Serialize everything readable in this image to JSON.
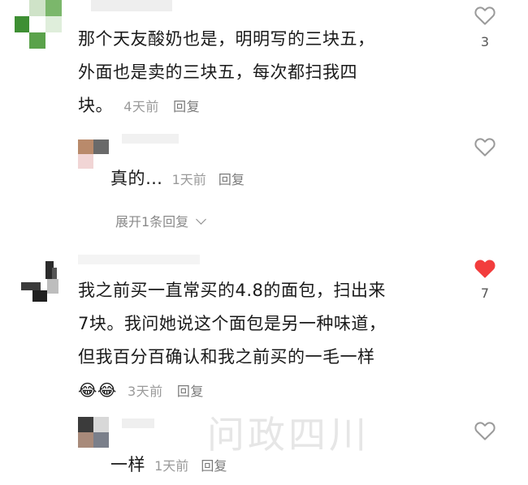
{
  "comments": [
    {
      "lines": [
        "那个天友酸奶也是，明明写的三块五，",
        "外面也是卖的三块五，每次都扫我四",
        "块。"
      ],
      "time": "4天前",
      "reply": "回复",
      "likes": "3",
      "liked": false,
      "replies": [
        {
          "text": "真的…",
          "time": "1天前",
          "reply": "回复"
        }
      ],
      "expand": "展开1条回复"
    },
    {
      "lines": [
        "我之前买一直常买的4.8的面包，扫出来",
        "7块。我问她说这个面包是另一种味道，",
        "但我百分百确认和我之前买的一毛一样"
      ],
      "emoji": [
        "😂",
        "😂"
      ],
      "time": "3天前",
      "reply": "回复",
      "likes": "7",
      "liked": true,
      "replies": [
        {
          "text": "一样",
          "time": "1天前",
          "reply": "回复"
        }
      ]
    }
  ],
  "watermark": {
    "main": "问政四川"
  },
  "colors": {
    "like_active": "#f23d3d",
    "like_idle": "#9a9a9a",
    "avatar_green": "#4a9a3a"
  },
  "icons": {
    "like": "heart-icon",
    "expand": "chevron-down-icon"
  }
}
